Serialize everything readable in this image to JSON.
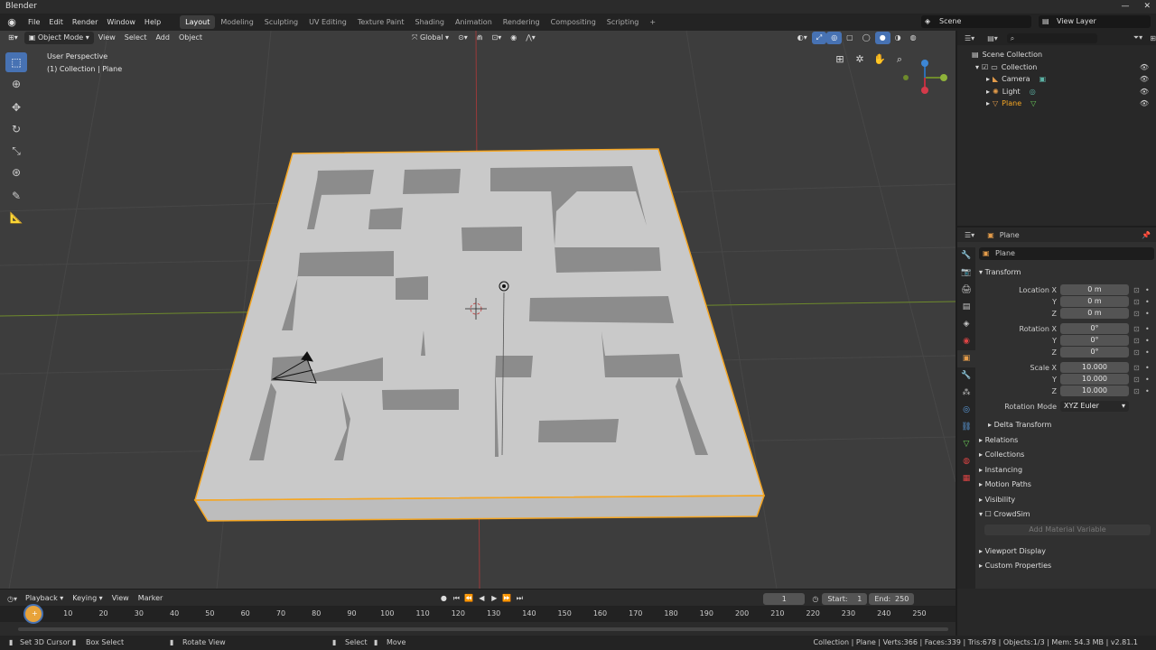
{
  "window": {
    "title": "Blender"
  },
  "topbar": {
    "menus": [
      "File",
      "Edit",
      "Render",
      "Window",
      "Help"
    ],
    "workspaces": [
      "Layout",
      "Modeling",
      "Sculpting",
      "UV Editing",
      "Texture Paint",
      "Shading",
      "Animation",
      "Rendering",
      "Compositing",
      "Scripting"
    ],
    "active_workspace": "Layout",
    "scene": "Scene",
    "view_layer": "View Layer"
  },
  "viewport_header": {
    "mode": "Object Mode",
    "menus": [
      "View",
      "Select",
      "Add",
      "Object"
    ],
    "transform_orientation": "Global"
  },
  "viewport": {
    "perspective_label": "User Perspective",
    "collection_label": "(1) Collection | Plane"
  },
  "outliner": {
    "root": "Scene Collection",
    "collection": "Collection",
    "objects": [
      "Camera",
      "Light",
      "Plane"
    ],
    "search_placeholder": ""
  },
  "properties": {
    "object_name_header": "Plane",
    "object_name": "Plane",
    "transform_title": "Transform",
    "location": {
      "label": "Location X",
      "x": "0 m",
      "y": "0 m",
      "z": "0 m"
    },
    "rotation": {
      "label": "Rotation X",
      "x": "0°",
      "y": "0°",
      "z": "0°"
    },
    "scale": {
      "label": "Scale X",
      "x": "10.000",
      "y": "10.000",
      "z": "10.000"
    },
    "axis_labels": {
      "y": "Y",
      "z": "Z"
    },
    "rotation_mode_label": "Rotation Mode",
    "rotation_mode": "XYZ Euler",
    "delta_transform": "Delta Transform",
    "panels": [
      "Relations",
      "Collections",
      "Instancing",
      "Motion Paths",
      "Visibility",
      "CrowdSim"
    ],
    "add_material_variable": "Add Material Variable",
    "panels_bottom": [
      "Viewport Display",
      "Custom Properties"
    ]
  },
  "timeline": {
    "menus": [
      "Playback",
      "Keying",
      "View",
      "Marker"
    ],
    "current_frame": "1",
    "start_label": "Start:",
    "start": "1",
    "end_label": "End:",
    "end": "250",
    "ticks": [
      "0",
      "10",
      "20",
      "30",
      "40",
      "50",
      "60",
      "70",
      "80",
      "90",
      "100",
      "110",
      "120",
      "130",
      "140",
      "150",
      "160",
      "170",
      "180",
      "190",
      "200",
      "210",
      "220",
      "230",
      "240",
      "250"
    ]
  },
  "statusbar": {
    "set_3d_cursor": "Set 3D Cursor",
    "box_select": "Box Select",
    "rotate_view": "Rotate View",
    "select": "Select",
    "move": "Move",
    "stats": "Collection | Plane | Verts:366 | Faces:339 | Tris:678 | Objects:1/3 | Mem: 54.3 MB | v2.81.1"
  },
  "colors": {
    "accent": "#4772b3",
    "selection_outline": "#f5a623",
    "viewport_bg": "#3d3d3d",
    "x_axis": "#9a3a3a",
    "y_axis": "#6e8a2c"
  }
}
